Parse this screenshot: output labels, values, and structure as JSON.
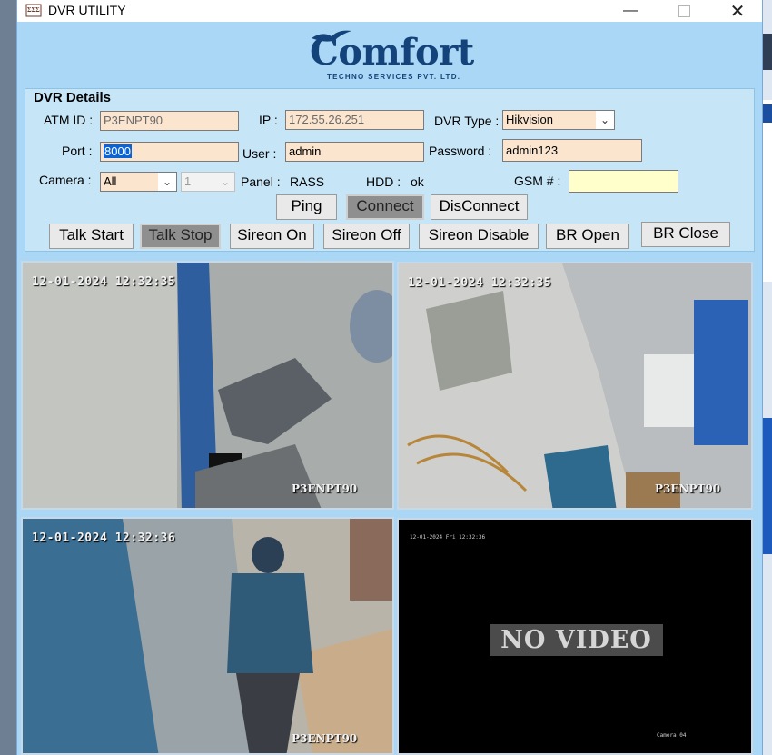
{
  "window": {
    "title": "DVR UTILITY",
    "icon_text": "ΣΣΣ"
  },
  "logo": {
    "main": "Comfort",
    "sub": "TECHNO SERVICES PVT. LTD."
  },
  "details": {
    "legend": "DVR Details",
    "atm_id_label": "ATM ID :",
    "atm_id_value": "P3ENPT90",
    "ip_label": "IP :",
    "ip_value": "172.55.26.251",
    "dvr_type_label": "DVR Type :",
    "dvr_type_value": "Hikvision",
    "port_label": "Port :",
    "port_value": "8000",
    "user_label": "User :",
    "user_value": "admin",
    "password_label": "Password :",
    "password_value": "admin123",
    "camera_label": "Camera :",
    "camera_value": "All",
    "camera_num_value": "1",
    "panel_label": "Panel :",
    "panel_value": "RASS",
    "hdd_label": "HDD :",
    "hdd_value": "ok",
    "gsm_label": "GSM # :",
    "gsm_value": ""
  },
  "buttons": {
    "ping": "Ping",
    "connect": "Connect",
    "disconnect": "DisConnect",
    "talk_start": "Talk Start",
    "talk_stop": "Talk Stop",
    "sireon_on": "Sireon On",
    "sireon_off": "Sireon Off",
    "sireon_disable": "Sireon Disable",
    "br_open": "BR Open",
    "br_close": "BR Close"
  },
  "cameras": [
    {
      "timestamp": "12-01-2024 12:32:35",
      "label": "P3ENPT90"
    },
    {
      "timestamp": "12-01-2024 12:32:35",
      "label": "P3ENPT90"
    },
    {
      "timestamp": "12-01-2024 12:32:36",
      "label": "P3ENPT90"
    },
    {
      "timestamp": "12-01-2024 Fri 12:32:36",
      "label": "Camera 04",
      "status": "NO VIDEO"
    }
  ],
  "colors": {
    "window_bg": "#a9d7f5",
    "details_bg": "#c6e6f8",
    "field_bg": "#fbe5cf",
    "gsm_bg": "#ffffcc",
    "logo": "#14427a"
  }
}
